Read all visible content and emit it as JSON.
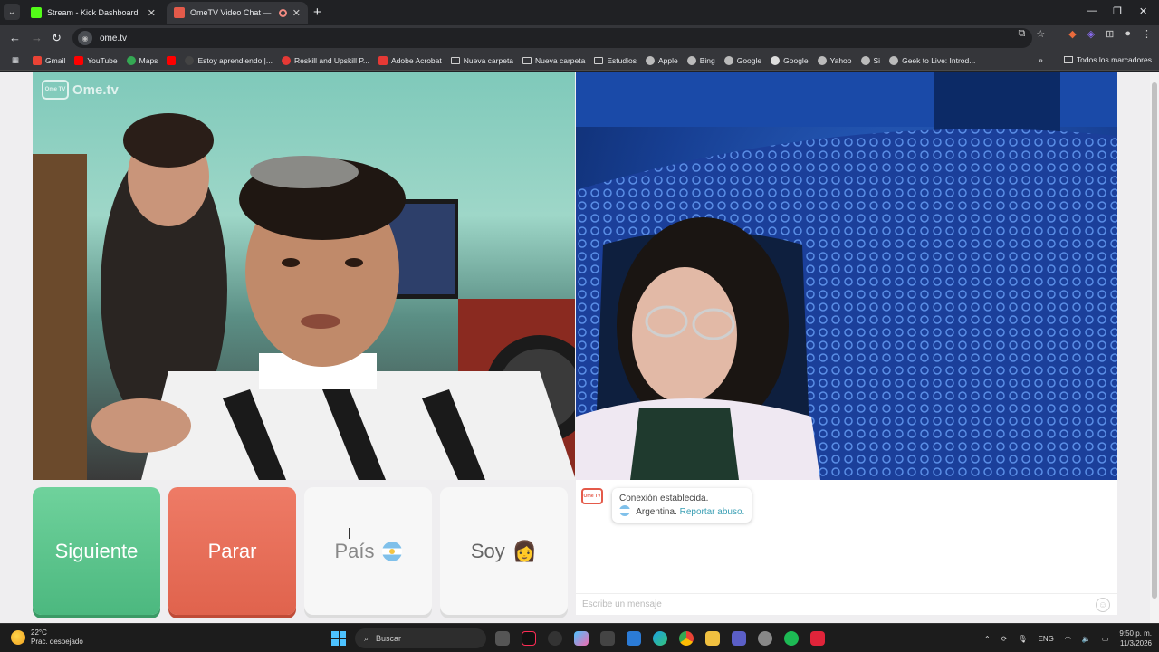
{
  "browser": {
    "tabs": [
      {
        "title": "Stream - Kick Dashboard",
        "active": false,
        "favicon_color": "#53fc18"
      },
      {
        "title": "OmeTV Video Chat — Ome",
        "active": true,
        "favicon_color": "#e45a4a"
      }
    ],
    "url": "ome.tv",
    "bookmarks": [
      {
        "label": "Gmail",
        "icon": "gmail-icon",
        "color": "#ea4335"
      },
      {
        "label": "YouTube",
        "icon": "youtube-icon",
        "color": "#ff0000"
      },
      {
        "label": "Maps",
        "icon": "maps-icon",
        "color": "#34a853"
      },
      {
        "label": "",
        "icon": "youtube-icon",
        "color": "#ff0000"
      },
      {
        "label": "Estoy aprendiendo |...",
        "icon": "page-icon",
        "color": "#444"
      },
      {
        "label": "Reskill and Upskill P...",
        "icon": "page-icon",
        "color": "#e53935"
      },
      {
        "label": "Adobe Acrobat",
        "icon": "acrobat-icon",
        "color": "#e53935"
      },
      {
        "label": "Nueva carpeta",
        "icon": "folder-icon",
        "color": ""
      },
      {
        "label": "Nueva carpeta",
        "icon": "folder-icon",
        "color": ""
      },
      {
        "label": "Estudios",
        "icon": "folder-icon",
        "color": ""
      },
      {
        "label": "Apple",
        "icon": "globe-icon",
        "color": "#bbb"
      },
      {
        "label": "Bing",
        "icon": "globe-icon",
        "color": "#bbb"
      },
      {
        "label": "Google",
        "icon": "globe-icon",
        "color": "#bbb"
      },
      {
        "label": "Google",
        "icon": "google-icon",
        "color": "#ddd"
      },
      {
        "label": "Yahoo",
        "icon": "globe-icon",
        "color": "#bbb"
      },
      {
        "label": "Si",
        "icon": "globe-icon",
        "color": "#bbb"
      },
      {
        "label": "Geek to Live: Introd...",
        "icon": "globe-icon",
        "color": "#bbb"
      }
    ],
    "all_bookmarks": "Todos los marcadores"
  },
  "page": {
    "logo_text": "Ome.tv",
    "logo_small": "Ome TV",
    "buttons": {
      "next": "Siguiente",
      "stop": "Parar",
      "country": "País",
      "gender": "Soy"
    },
    "chat": {
      "system_line1": "Conexión establecida.",
      "country": "Argentina.",
      "report_link": "Reportar abuso.",
      "input_placeholder": "Escribe un mensaje"
    }
  },
  "taskbar": {
    "temperature": "22°C",
    "weather": "Prac. despejado",
    "search": "Buscar",
    "language": "ENG",
    "time": "9:50 p. m.",
    "date": "11/3/2026"
  }
}
